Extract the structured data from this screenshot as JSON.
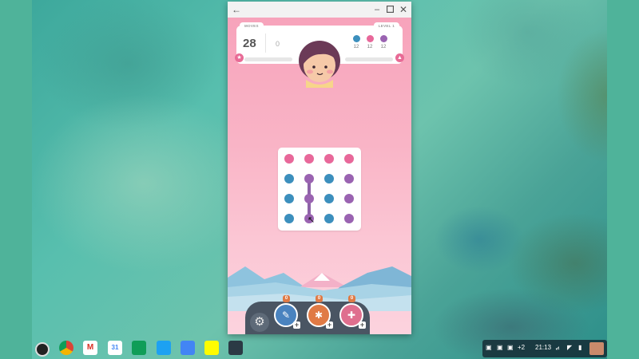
{
  "window": {
    "back_icon": "arrow-left-icon",
    "controls": [
      "minimize-icon",
      "maximize-icon",
      "close-icon"
    ]
  },
  "hud": {
    "moves_label": "MOVES",
    "moves_value": "28",
    "score_value": "0",
    "level_label": "LEVEL 1",
    "goals": [
      {
        "color": "#3c8fbd",
        "count": "12"
      },
      {
        "color": "#e8689a",
        "count": "12"
      },
      {
        "color": "#9a63b1",
        "count": "12"
      }
    ]
  },
  "board": {
    "colors": {
      "pink": "#e8689a",
      "blue": "#3c8fbd",
      "purple": "#9a63b1",
      "link": "#8e63a8"
    },
    "grid": [
      [
        "pink",
        "pink",
        "pink",
        "pink"
      ],
      [
        "blue",
        "purple",
        "blue",
        "purple"
      ],
      [
        "blue",
        "purple",
        "blue",
        "purple"
      ],
      [
        "blue",
        "purple",
        "blue",
        "purple"
      ]
    ],
    "connected_column": 1,
    "connected_rows": [
      1,
      2,
      3
    ]
  },
  "powerups": [
    {
      "name": "eraser",
      "count": "0",
      "color": "#4a83bf"
    },
    {
      "name": "bomb",
      "count": "0",
      "color": "#e07a45"
    },
    {
      "name": "expander",
      "count": "0",
      "color": "#df6f8e"
    }
  ],
  "shelf": {
    "apps": [
      {
        "name": "launcher",
        "label": "",
        "color": "#222222"
      },
      {
        "name": "chrome",
        "label": "",
        "color": "#db4437"
      },
      {
        "name": "gmail",
        "label": "M",
        "color": "#d93025"
      },
      {
        "name": "calendar",
        "label": "31",
        "color": "#4285f4"
      },
      {
        "name": "drive",
        "label": "",
        "color": "#0f9d58"
      },
      {
        "name": "twitter",
        "label": "",
        "color": "#1da1f2"
      },
      {
        "name": "play-store",
        "label": "",
        "color": "#4285f4"
      },
      {
        "name": "snapchat",
        "label": "",
        "color": "#fffc00"
      },
      {
        "name": "two-dots",
        "label": "",
        "color": "#2b3a45"
      }
    ],
    "notification_count": "+2",
    "time": "21:13"
  }
}
